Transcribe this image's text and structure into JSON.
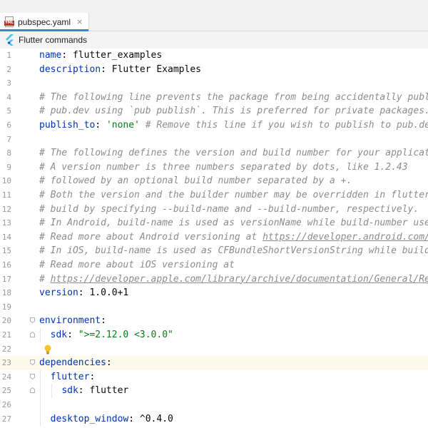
{
  "tab": {
    "label": "pubspec.yaml",
    "close": "×",
    "icon": "yaml-file-icon",
    "icon_text": "YML"
  },
  "toolbar": {
    "label": "Flutter commands",
    "icon": "flutter-icon"
  },
  "colors": {
    "key": "#0033b3",
    "comment": "#8c8c8c",
    "string": "#067d17",
    "number": "#1750eb",
    "accent": "#4083c9",
    "current_line": "#fcfaed"
  },
  "editor": {
    "current_line": 23,
    "lines": [
      {
        "n": "1",
        "indent": "",
        "parts": [
          {
            "t": "name",
            "c": "k"
          },
          {
            "t": ": flutter_examples"
          }
        ]
      },
      {
        "n": "2",
        "indent": "",
        "parts": [
          {
            "t": "description",
            "c": "k"
          },
          {
            "t": ": Flutter Examples"
          }
        ]
      },
      {
        "n": "3",
        "indent": "",
        "parts": []
      },
      {
        "n": "4",
        "indent": "",
        "parts": [
          {
            "t": "# The following line prevents the package from being accidentally publish",
            "c": "c"
          }
        ]
      },
      {
        "n": "5",
        "indent": "",
        "parts": [
          {
            "t": "# pub.dev using `pub publish`. This is preferred for private packages.",
            "c": "c"
          }
        ]
      },
      {
        "n": "6",
        "indent": "",
        "parts": [
          {
            "t": "publish_to",
            "c": "k"
          },
          {
            "t": ": "
          },
          {
            "t": "'none'",
            "c": "s"
          },
          {
            "t": " # Remove this line if you wish to publish to pub.dev",
            "c": "c"
          }
        ]
      },
      {
        "n": "7",
        "indent": "",
        "parts": []
      },
      {
        "n": "8",
        "indent": "",
        "parts": [
          {
            "t": "# The following defines the version and build number for your application",
            "c": "c"
          }
        ]
      },
      {
        "n": "9",
        "indent": "",
        "parts": [
          {
            "t": "# A version number is three numbers separated by dots, like 1.2.43",
            "c": "c"
          }
        ]
      },
      {
        "n": "10",
        "indent": "",
        "parts": [
          {
            "t": "# followed by an optional build number separated by a +.",
            "c": "c"
          }
        ]
      },
      {
        "n": "11",
        "indent": "",
        "parts": [
          {
            "t": "# Both the version and the builder number may be overridden in flutter",
            "c": "c"
          }
        ]
      },
      {
        "n": "12",
        "indent": "",
        "parts": [
          {
            "t": "# build by specifying --build-name and --build-number, respectively.",
            "c": "c"
          }
        ]
      },
      {
        "n": "13",
        "indent": "",
        "parts": [
          {
            "t": "# In Android, build-name is used as versionName while build-number used a",
            "c": "c"
          }
        ]
      },
      {
        "n": "14",
        "indent": "",
        "parts": [
          {
            "t": "# Read more about Android versioning at ",
            "c": "c"
          },
          {
            "t": "https://developer.android.com/stu",
            "c": "cu"
          }
        ]
      },
      {
        "n": "15",
        "indent": "",
        "parts": [
          {
            "t": "# In iOS, build-name is used as CFBundleShortVersionString while build-nu",
            "c": "c"
          }
        ]
      },
      {
        "n": "16",
        "indent": "",
        "parts": [
          {
            "t": "# Read more about iOS versioning at",
            "c": "c"
          }
        ]
      },
      {
        "n": "17",
        "indent": "",
        "parts": [
          {
            "t": "# ",
            "c": "c"
          },
          {
            "t": "https://developer.apple.com/library/archive/documentation/General/Refer",
            "c": "cu"
          }
        ]
      },
      {
        "n": "18",
        "indent": "",
        "parts": [
          {
            "t": "version",
            "c": "k"
          },
          {
            "t": ": 1.0.0+1"
          }
        ]
      },
      {
        "n": "19",
        "indent": "",
        "parts": []
      },
      {
        "n": "20",
        "indent": "",
        "parts": [
          {
            "t": "environment",
            "c": "k"
          },
          {
            "t": ":"
          }
        ],
        "fold": "open"
      },
      {
        "n": "21",
        "indent": "  ",
        "parts": [
          {
            "t": "sdk",
            "c": "k"
          },
          {
            "t": ": "
          },
          {
            "t": "\">=2.12.0 <3.0.0\"",
            "c": "s"
          }
        ],
        "fold": "end"
      },
      {
        "n": "22",
        "indent": "",
        "parts": [],
        "bulb": true
      },
      {
        "n": "23",
        "indent": "",
        "parts": [
          {
            "t": "dependencies",
            "c": "k"
          },
          {
            "t": ":"
          }
        ],
        "fold": "open"
      },
      {
        "n": "24",
        "indent": "  ",
        "parts": [
          {
            "t": "flutter",
            "c": "k"
          },
          {
            "t": ":"
          }
        ],
        "fold": "open"
      },
      {
        "n": "25",
        "indent": "    ",
        "parts": [
          {
            "t": "sdk",
            "c": "k"
          },
          {
            "t": ": flutter"
          }
        ],
        "fold": "end"
      },
      {
        "n": "26",
        "indent": "",
        "parts": []
      },
      {
        "n": "27",
        "indent": "  ",
        "parts": [
          {
            "t": "desktop_window",
            "c": "k"
          },
          {
            "t": ": ^0.4.0"
          }
        ]
      }
    ]
  }
}
